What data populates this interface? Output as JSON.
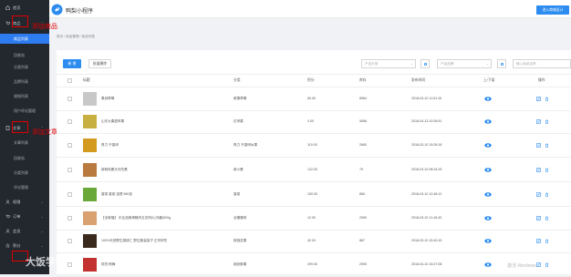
{
  "app": {
    "title": "鸭梨小程序",
    "action_button": "进入商城设计"
  },
  "sidebar": {
    "home": "首页",
    "goods": "商品",
    "goods_subs": [
      "商品列表",
      "回收站",
      "分类列表",
      "品牌列表",
      "规格列表",
      "用户评论管理"
    ],
    "article": "文章",
    "article_subs": [
      "文章列表",
      "回收站",
      "分类列表",
      "评论管理"
    ],
    "bottom_items": [
      "权限",
      "订单",
      "会员",
      "积分"
    ]
  },
  "annotations": {
    "goods": "添加商品",
    "article": "添加文章",
    "watermark": "大饭学院"
  },
  "breadcrumb": "首页 / 商品管理 / 商品列表",
  "toolbar": {
    "add_label": "新 增",
    "bulk_label": "批量删除",
    "filter1": "产品分类",
    "filter2": "产品品牌",
    "search_placeholder": "输入商品名称"
  },
  "table": {
    "headers": [
      "标题",
      "分类",
      "积分",
      "库存",
      "发布时间",
      "上/下架",
      "操作"
    ],
    "rows": [
      {
        "title": "果然草莓",
        "category": "鲜果草莓",
        "points": "80.00",
        "stock": "8984",
        "time": "2018-03-10 11:51:16",
        "thumb_color": "#c8c8c8"
      },
      {
        "title": "山东大果甜苹果",
        "category": "红苹果",
        "points": "3.00",
        "stock": "5556",
        "time": "2018-04-13 10:26:51",
        "thumb_color": "#c8b040"
      },
      {
        "title": "咚力 不香呀",
        "category": "咚力 不香呀水果",
        "points": "119.00",
        "stock": "2660",
        "time": "2018-03-10 15:28:18",
        "thumb_color": "#d49a20"
      },
      {
        "title": "新鲜鸡蛋天天吃蛋",
        "category": "新小蛋",
        "points": "122.00",
        "stock": "79",
        "time": "2018-03-10 08:24:25",
        "thumb_color": "#b97a40"
      },
      {
        "title": "香菜 香菜 连根 560克",
        "category": "香菜",
        "points": "100.00",
        "stock": "866",
        "time": "2018-03-10 12:48:12",
        "thumb_color": "#6aa83a"
      },
      {
        "title": "【全家福】 乐比品鲜烤猪肉五花肉片(冷藏)500g",
        "category": "全猪猪肉",
        "points": "12.00",
        "stock": "2990",
        "time": "2018-03-10 11:16:43",
        "thumb_color": "#d9a070"
      },
      {
        "title": "100%天然野生核桃仁 野生散装袋子 正宗好吃",
        "category": "核桃坚果",
        "points": "42.00",
        "stock": "887",
        "time": "2018-03-10 15:40:15",
        "thumb_color": "#3a2a1e"
      },
      {
        "title": "现货 杨梅",
        "category": "缤纷鲜果",
        "points": "299.00",
        "stock": "2990",
        "time": "2018-03-10 15:27:08",
        "thumb_color": "#c23030"
      }
    ]
  },
  "os_watermark": "激活 Windows",
  "colors": {
    "sidebar_bg": "#23272e",
    "accent": "#2d8cf0",
    "annotation": "#e00000"
  }
}
